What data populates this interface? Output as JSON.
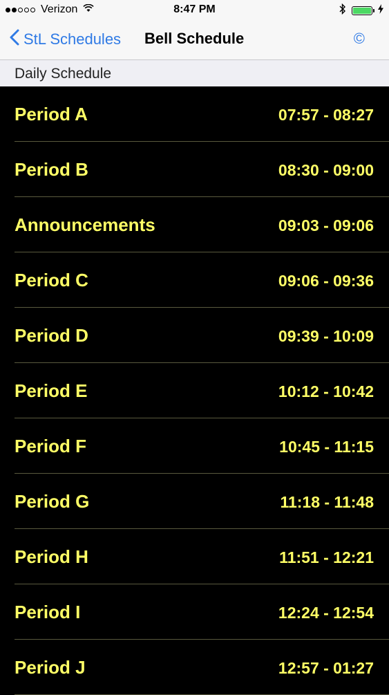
{
  "status_bar": {
    "carrier": "Verizon",
    "signal_bars_filled": 2,
    "signal_bars_total": 5,
    "time": "8:47 PM",
    "battery_level_percent": 100
  },
  "nav": {
    "back_label": "StL Schedules",
    "title": "Bell Schedule",
    "right_icon_glyph": "©",
    "accent_color": "#2f7ae5"
  },
  "section": {
    "header": "Daily Schedule"
  },
  "theme": {
    "list_background": "#000000",
    "text_color": "#ffff66"
  },
  "schedule": [
    {
      "name": "Period A",
      "time": "07:57 - 08:27"
    },
    {
      "name": "Period B",
      "time": "08:30 - 09:00"
    },
    {
      "name": "Announcements",
      "time": "09:03 - 09:06"
    },
    {
      "name": "Period C",
      "time": "09:06 - 09:36"
    },
    {
      "name": "Period D",
      "time": "09:39 - 10:09"
    },
    {
      "name": "Period E",
      "time": "10:12 - 10:42"
    },
    {
      "name": "Period F",
      "time": "10:45 - 11:15"
    },
    {
      "name": "Period G",
      "time": "11:18 - 11:48"
    },
    {
      "name": "Period H",
      "time": "11:51 - 12:21"
    },
    {
      "name": "Period I",
      "time": "12:24 - 12:54"
    },
    {
      "name": "Period J",
      "time": "12:57 - 01:27"
    }
  ]
}
